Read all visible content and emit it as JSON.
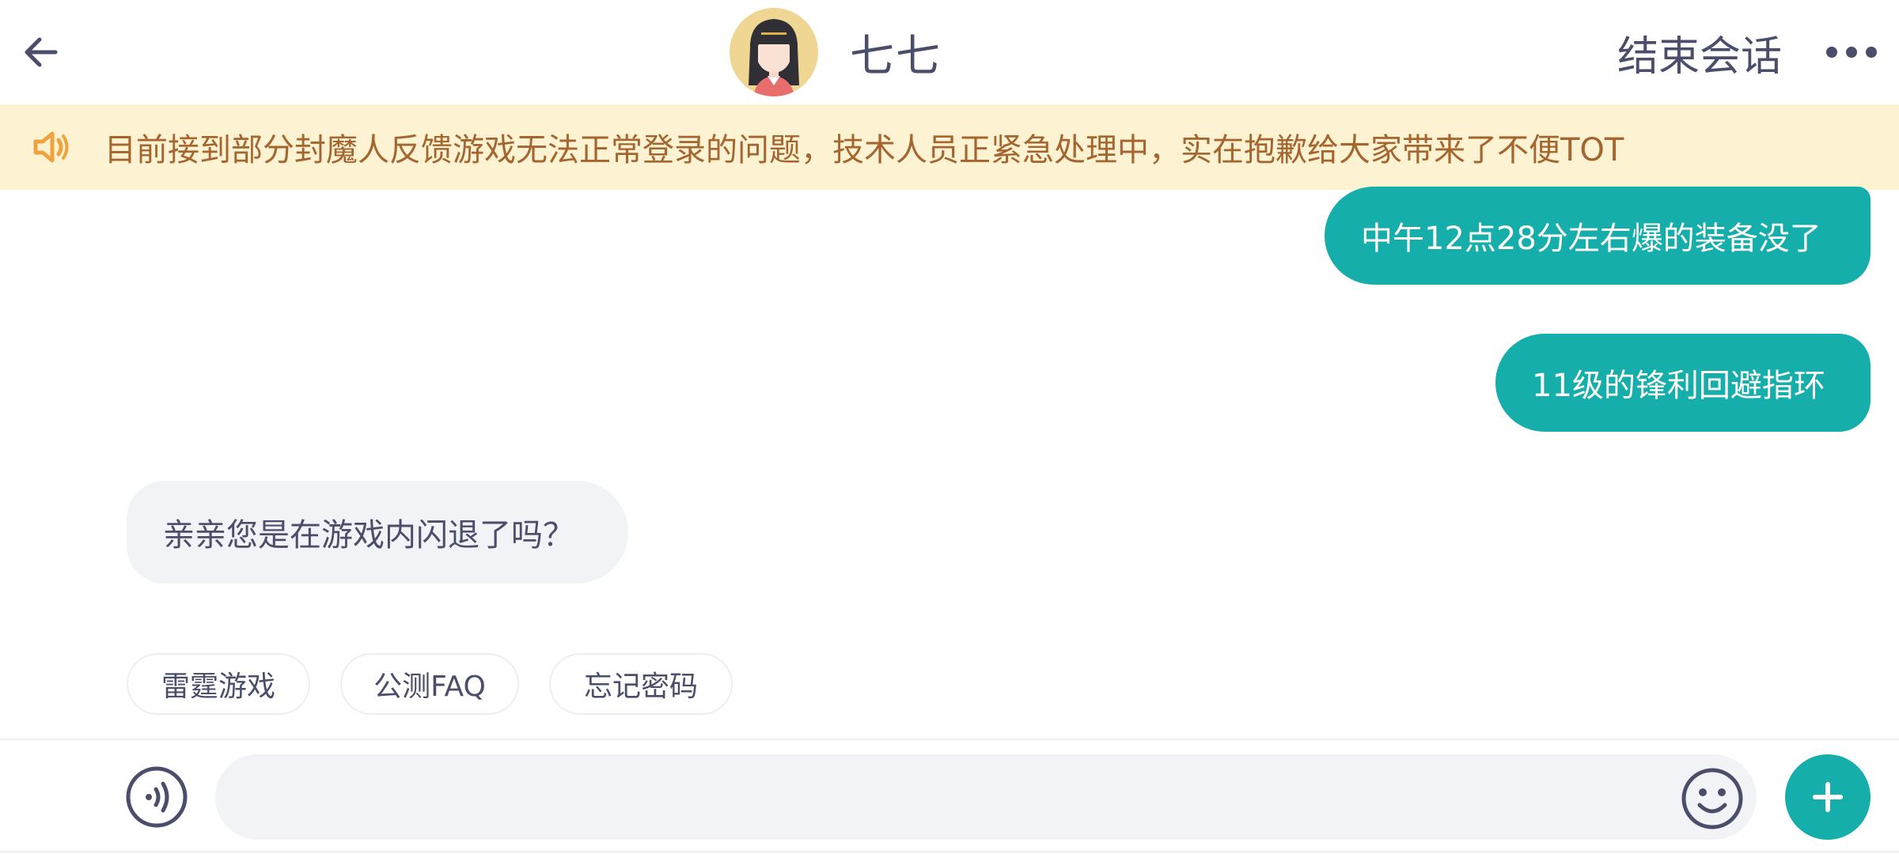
{
  "header": {
    "title": "七七",
    "end_button_label": "结束会话",
    "back_icon": "arrow-left-icon",
    "more_icon": "more-dots-icon",
    "avatar": "avatar"
  },
  "notice": {
    "icon": "speaker-icon",
    "text": "目前接到部分封魔人反馈游戏无法正常登录的问题，技术人员正紧急处理中，实在抱歉给大家带来了不便TOT"
  },
  "messages": [
    {
      "side": "right",
      "text": "中午12点28分左右爆的装备没了"
    },
    {
      "side": "right",
      "text": "11级的锋利回避指环"
    },
    {
      "side": "left",
      "text": "亲亲您是在游戏内闪退了吗？"
    }
  ],
  "quick_replies": [
    "雷霆游戏",
    "公测FAQ",
    "忘记密码"
  ],
  "input_bar": {
    "value": "",
    "placeholder": "",
    "voice_icon": "voice-icon",
    "emoji_icon": "emoji-icon",
    "plus_icon": "plus-icon"
  },
  "colors": {
    "accent": "#15aeab",
    "notice_bg": "#fdf3d3",
    "notice_text": "#a4652f",
    "bubble_left_bg": "#f1f3f7",
    "text": "#4a4e6b"
  }
}
